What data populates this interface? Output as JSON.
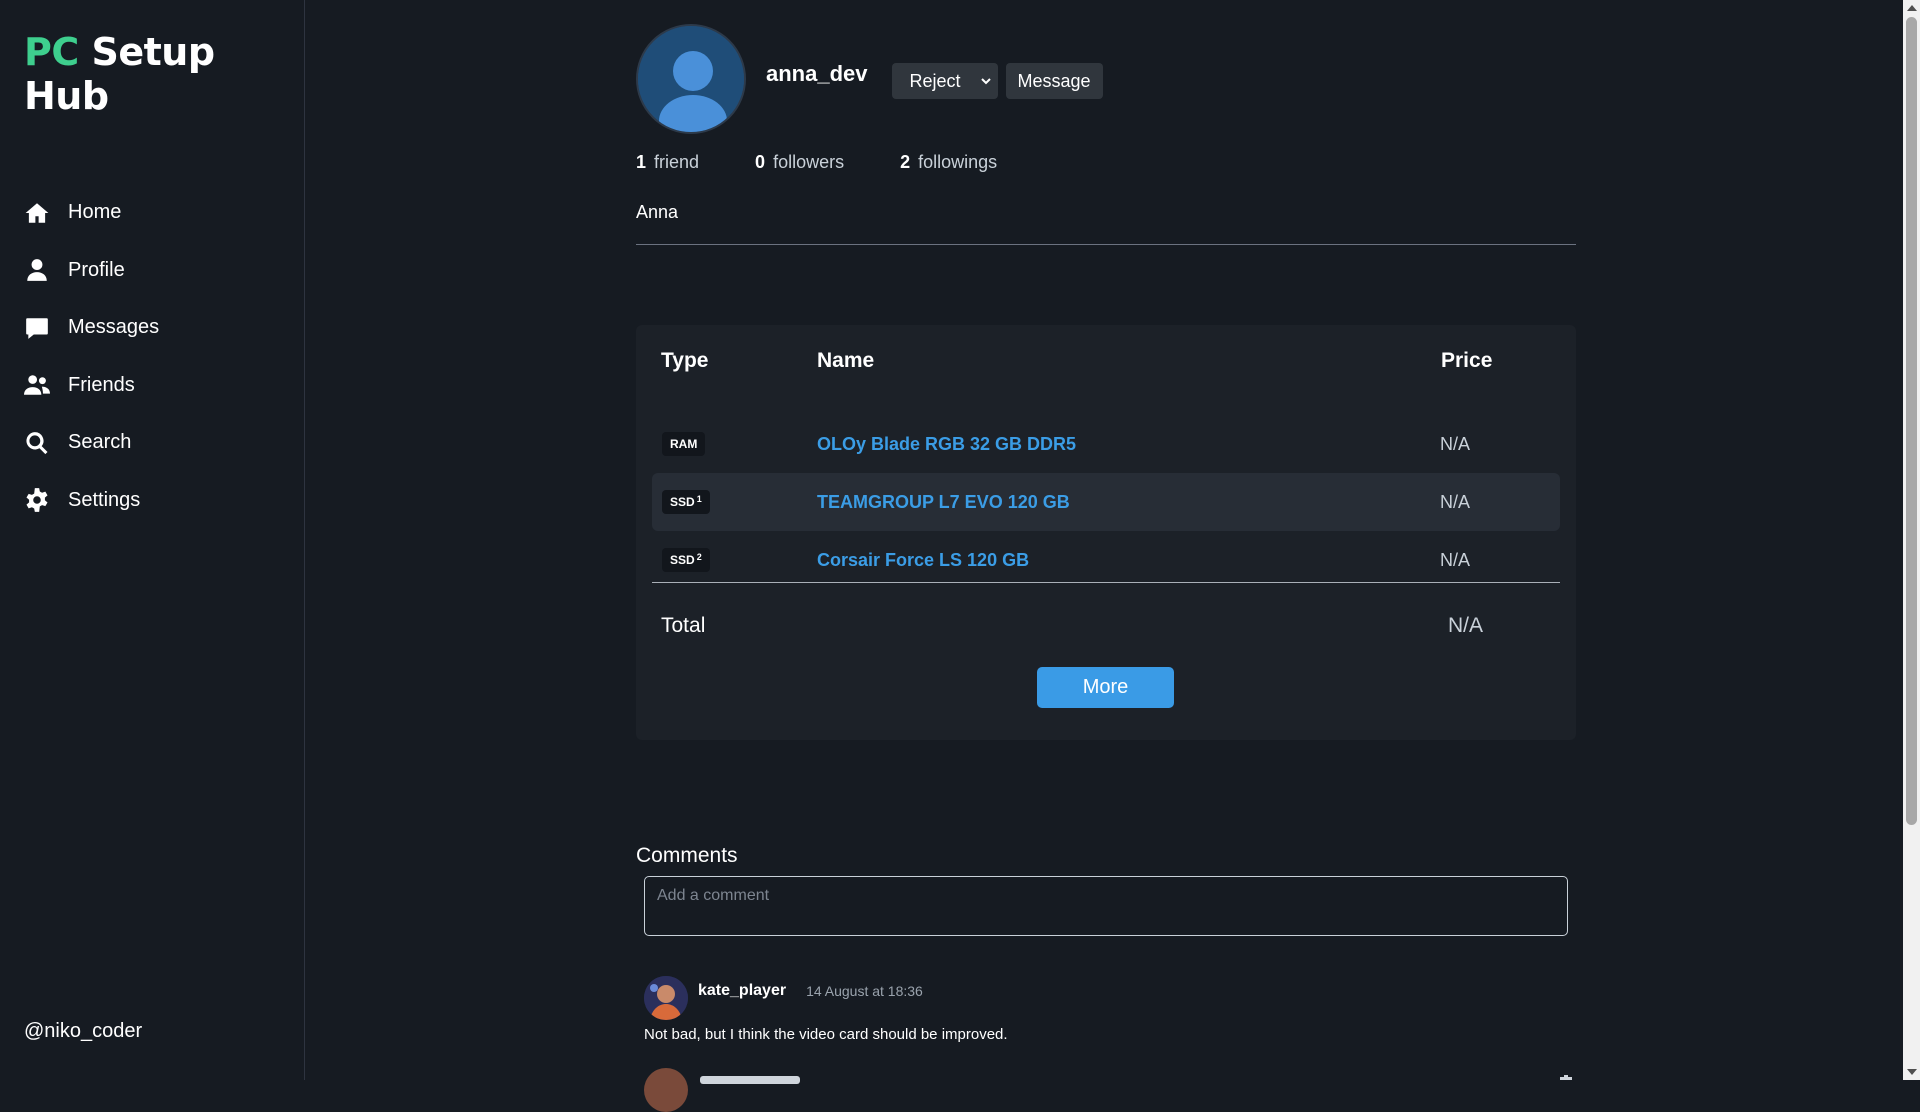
{
  "app": {
    "logo_part1": "PC",
    "logo_part2": " Setup Hub",
    "current_user": "@niko_coder"
  },
  "sidebar": {
    "items": [
      {
        "label": "Home",
        "icon": "home-icon"
      },
      {
        "label": "Profile",
        "icon": "user-icon"
      },
      {
        "label": "Messages",
        "icon": "message-icon"
      },
      {
        "label": "Friends",
        "icon": "users-icon"
      },
      {
        "label": "Search",
        "icon": "search-icon"
      },
      {
        "label": "Settings",
        "icon": "gear-icon"
      }
    ]
  },
  "profile": {
    "username": "anna_dev",
    "display_name": "Anna",
    "action_select": "Reject",
    "message_button": "Message",
    "friends_count": "1",
    "friends_label": "friend",
    "followers_count": "0",
    "followers_label": "followers",
    "followings_count": "2",
    "followings_label": "followings"
  },
  "build": {
    "headers": {
      "type": "Type",
      "name": "Name",
      "price": "Price"
    },
    "rows": [
      {
        "type": "RAM",
        "sup": "",
        "name": "OLOy Blade RGB 32 GB DDR5",
        "price": "N/A"
      },
      {
        "type": "SSD",
        "sup": "1",
        "name": "TEAMGROUP L7 EVO 120 GB",
        "price": "N/A"
      },
      {
        "type": "SSD",
        "sup": "2",
        "name": "Corsair Force LS 120 GB",
        "price": "N/A"
      }
    ],
    "total_label": "Total",
    "total_value": "N/A",
    "more_button": "More"
  },
  "comments": {
    "title": "Comments",
    "placeholder": "Add a comment",
    "items": [
      {
        "author": "kate_player",
        "time": "14 August at 18:36",
        "text": "Not bad, but I think the video card should be improved."
      }
    ]
  },
  "colors": {
    "background": "#161b22",
    "accent_green": "#3ecf8e",
    "link_blue": "#3b9de6",
    "button_blue": "#3a9be6"
  }
}
